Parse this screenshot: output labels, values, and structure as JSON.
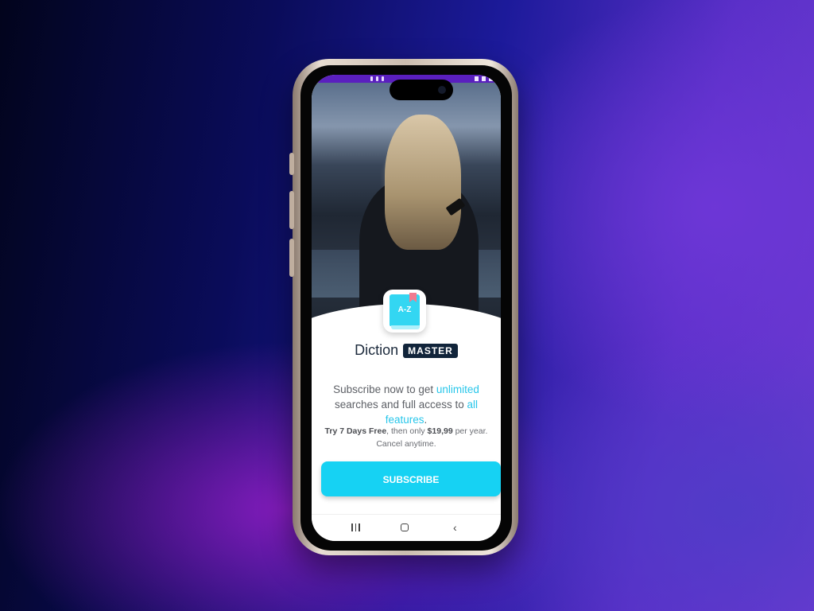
{
  "app": {
    "brand_word": "Diction",
    "brand_badge": "MASTER",
    "icon_text": "A-Z"
  },
  "paywall": {
    "headline_prefix": "Subscribe now to get ",
    "headline_highlight1": "unlimited",
    "headline_middle": " searches and full access to ",
    "headline_highlight2": "all features",
    "headline_suffix": ".",
    "trial_bold": "Try 7 Days Free",
    "trial_middle": ", then only ",
    "price": "$19,99",
    "trial_suffix": " per year.",
    "cancel_note": "Cancel anytime.",
    "subscribe_label": "SUBSCRIBE"
  },
  "colors": {
    "accent": "#16d2f3",
    "highlight": "#27c6ea",
    "brand_badge_bg": "#11243a",
    "status_bar": "#5a1fbf"
  },
  "icons": {
    "app_icon": "dictionary-book-icon",
    "nav_recent": "recent-apps-icon",
    "nav_home": "home-icon",
    "nav_back": "back-icon"
  }
}
